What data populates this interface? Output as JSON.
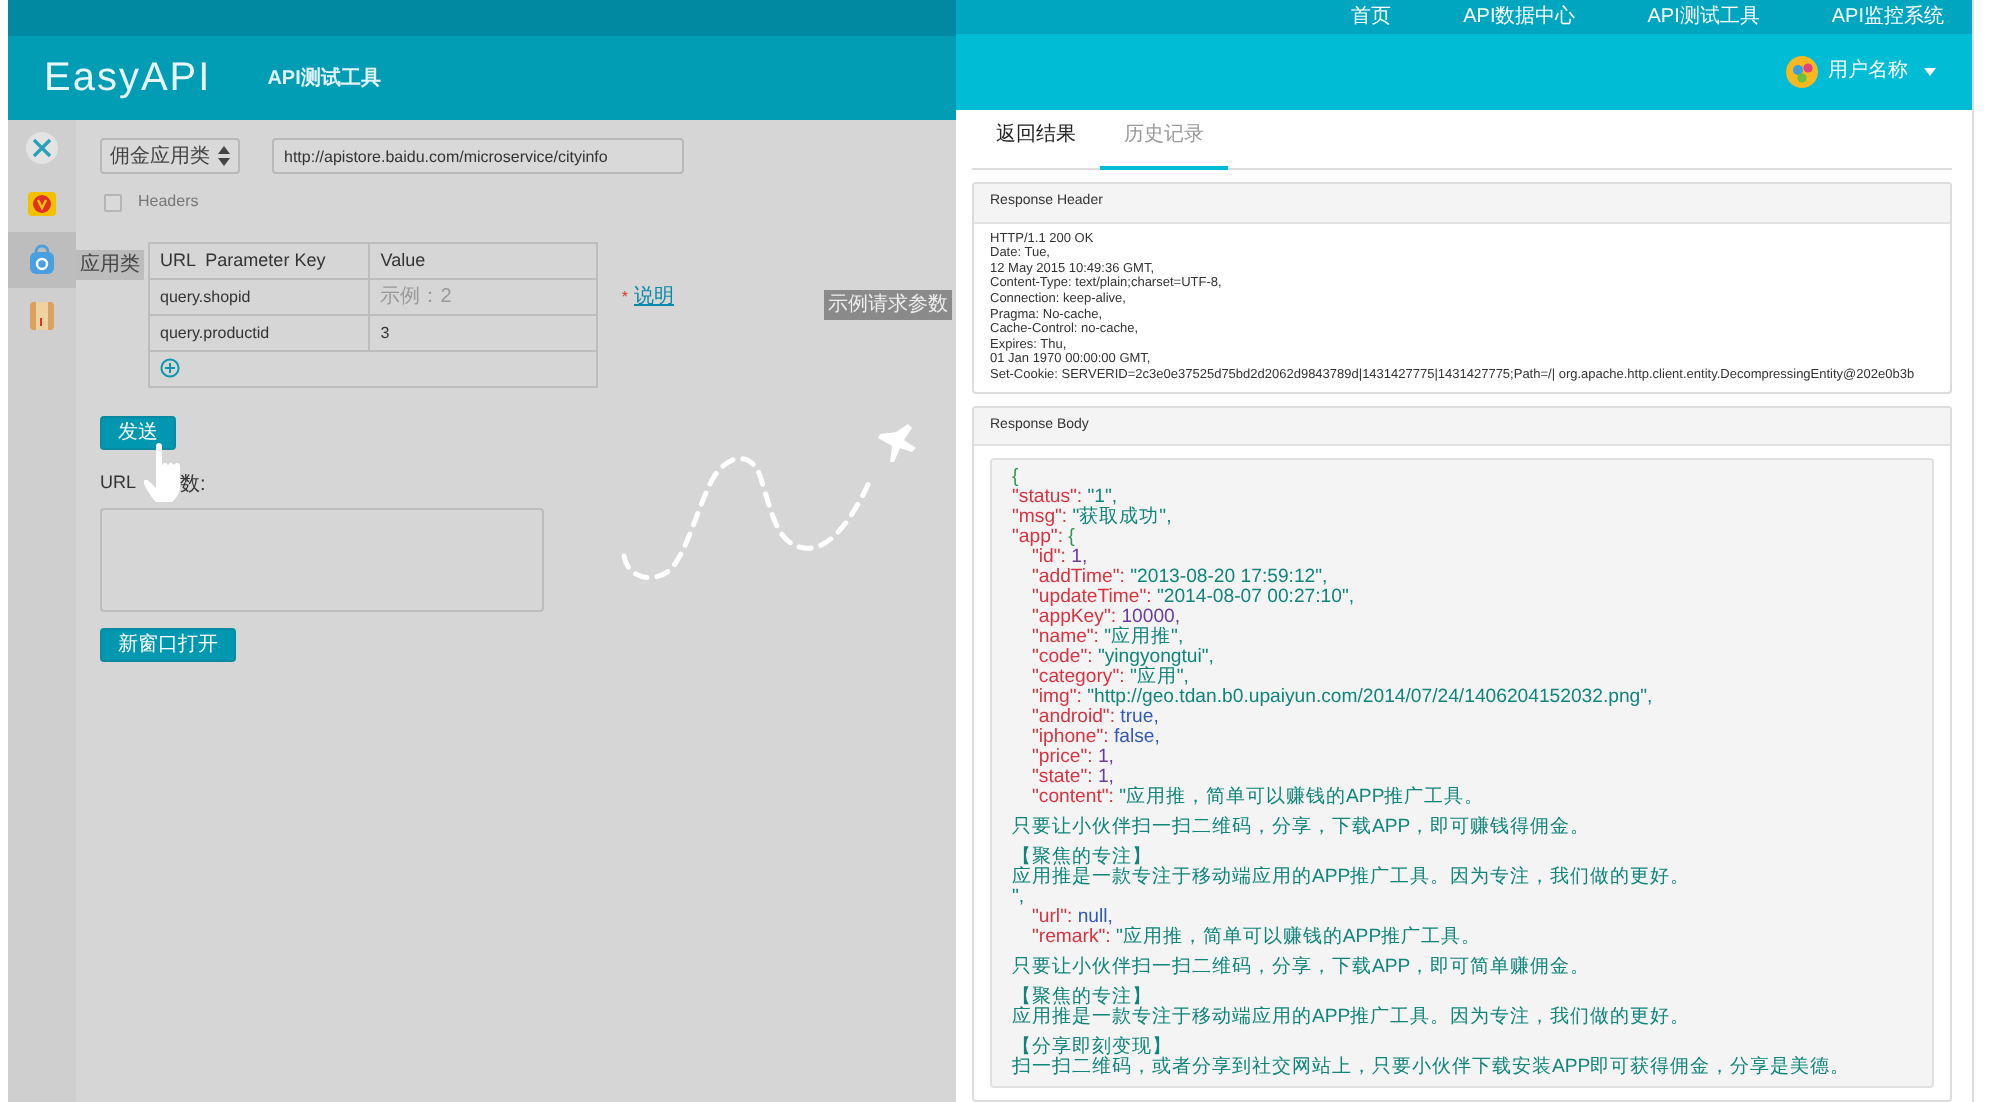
{
  "logo": "EasyAPI",
  "subtitle": "API测试工具",
  "top_nav": [
    {
      "label": "首页"
    },
    {
      "label": "API数据中心"
    },
    {
      "label": "API测试工具"
    },
    {
      "label": "API监控系统"
    }
  ],
  "user": {
    "name": "用户名称"
  },
  "sidebar": {
    "items": [
      {
        "selected": false
      },
      {
        "selected": false
      },
      {
        "selected": true,
        "tooltip": "应用类"
      },
      {
        "selected": false
      }
    ]
  },
  "request": {
    "method": "佣金应用类",
    "url": "http://apistore.baidu.com/microservice/cityinfo",
    "headers": {
      "label": "Headers",
      "checked": false
    },
    "table": {
      "columns": [
        "URL  Parameter Key",
        "Value"
      ],
      "rows": [
        {
          "key": "query.shopid",
          "placeholder": "示例：2",
          "note_mark": "*",
          "note": "说明"
        },
        {
          "key": "query.productid",
          "value": "3"
        }
      ]
    },
    "send": "发送",
    "url_label": [
      "URL",
      "数:"
    ],
    "open": "新窗口打开"
  },
  "float_tip": "示例请求参数",
  "tabs": [
    {
      "label": "返回结果",
      "selected": false
    },
    {
      "label": "历史记录",
      "selected": true
    }
  ],
  "response_header": {
    "title": "Response Header",
    "lines": [
      "HTTP/1.1 200 OK",
      "Date: Tue,",
      "12 May 2015 10:49:36 GMT,",
      "Content-Type: text/plain;charset=UTF-8,",
      "Connection: keep-alive,",
      "Pragma: No-cache,",
      "Cache-Control: no-cache,",
      "Expires: Thu,",
      "01 Jan 1970 00:00:00 GMT,",
      "Set-Cookie: SERVERID=2c3e0e37525d75bd2d2062d9843789d|1431427775|1431427775;Path=/| org.apache.http.client.entity.DecompressingEntity@202e0b3b"
    ]
  },
  "response_body": {
    "title": "Response Body",
    "lines": [
      {
        "kind": "brace",
        "text": "{"
      },
      {
        "kind": "string",
        "key": "\"status\":",
        "value": "\"1\","
      },
      {
        "kind": "string",
        "key": "\"msg\":",
        "value": "\"获取成功\","
      },
      {
        "kind": "object",
        "key": "\"app\":",
        "value": "{",
        "children": [
          {
            "kind": "number",
            "key": "\"id\":",
            "value": "1,"
          },
          {
            "kind": "string",
            "key": "\"addTime\":",
            "value": "\"2013-08-20 17:59:12\","
          },
          {
            "kind": "string",
            "key": "\"updateTime\":",
            "value": "\"2014-08-07 00:27:10\","
          },
          {
            "kind": "number",
            "key": "\"appKey\":",
            "value": "10000,"
          },
          {
            "kind": "string",
            "key": "\"name\":",
            "value": "\"应用推\","
          },
          {
            "kind": "string",
            "key": "\"code\":",
            "value": "\"yingyongtui\","
          },
          {
            "kind": "string",
            "key": "\"category\":",
            "value": "\"应用\","
          },
          {
            "kind": "string",
            "key": "\"img\":",
            "value": "\"http://geo.tdan.b0.upaiyun.com/2014/07/24/1406204152032.png\","
          },
          {
            "kind": "literal",
            "key": "\"android\":",
            "value": "true,"
          },
          {
            "kind": "literal",
            "key": "\"iphone\":",
            "value": "false,"
          },
          {
            "kind": "number",
            "key": "\"price\":",
            "value": "1,"
          },
          {
            "kind": "number",
            "key": "\"state\":",
            "value": "1,"
          },
          {
            "kind": "string",
            "key": "\"content\":",
            "value": "\"应用推，简单可以赚钱的APP推广工具。"
          }
        ]
      },
      {
        "kind": "text",
        "text": "只要让小伙伴扫一扫二维码，分享，下载APP，即可赚钱得佣金。",
        "spaced": true
      },
      {
        "kind": "text",
        "text": "【聚焦的专注】",
        "spaced": true
      },
      {
        "kind": "text",
        "text": "应用推是一款专注于移动端应用的APP推广工具。因为专注，我们做的更好。"
      },
      {
        "kind": "text",
        "text": "\","
      },
      {
        "kind": "literal",
        "key": "\"url\":",
        "value": "null,",
        "nested": true
      },
      {
        "kind": "string",
        "key": "\"remark\":",
        "value": "\"应用推，简单可以赚钱的APP推广工具。",
        "nested": true
      },
      {
        "kind": "text",
        "text": "只要让小伙伴扫一扫二维码，分享，下载APP，即可简单赚佣金。",
        "spaced": true
      },
      {
        "kind": "text",
        "text": "【聚焦的专注】",
        "spaced": true
      },
      {
        "kind": "text",
        "text": "应用推是一款专注于移动端应用的APP推广工具。因为专注，我们做的更好。"
      },
      {
        "kind": "text",
        "text": "【分享即刻变现】",
        "spaced": true
      },
      {
        "kind": "text",
        "text": "扫一扫二维码，或者分享到社交网站上，只要小伙伴下载安装APP即可获得佣金，分享是美德。"
      }
    ]
  }
}
